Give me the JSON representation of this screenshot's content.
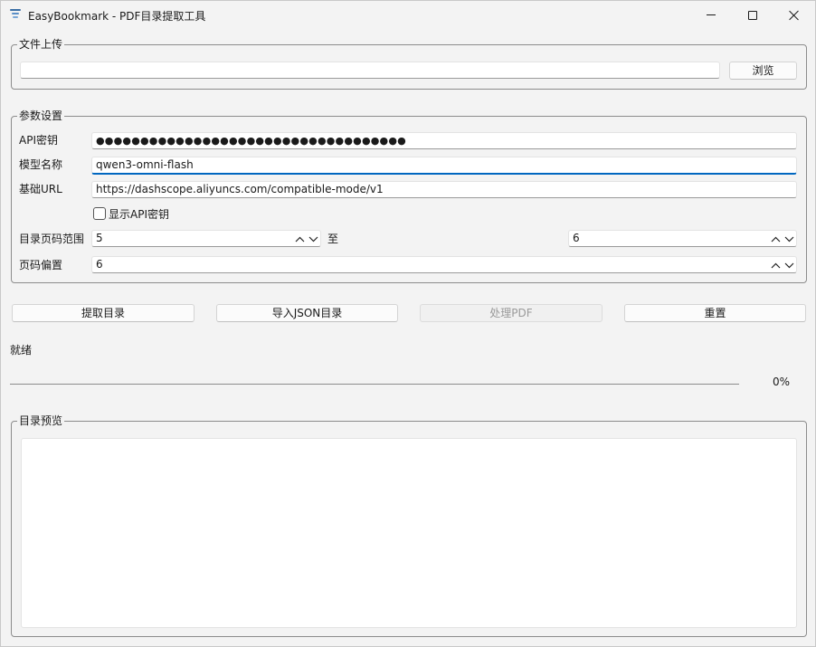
{
  "window": {
    "title": "EasyBookmark - PDF目录提取工具",
    "icon": "app-list-icon"
  },
  "upload": {
    "group_title": "文件上传",
    "file_path": "",
    "browse_label": "浏览"
  },
  "params": {
    "group_title": "参数设置",
    "api_key_label": "API密钥",
    "api_key_masked": "●●●●●●●●●●●●●●●●●●●●●●●●●●●●●●●●●●●",
    "model_label": "模型名称",
    "model_value": "qwen3-omni-flash",
    "base_url_label": "基础URL",
    "base_url_value": "https://dashscope.aliyuncs.com/compatible-mode/v1",
    "show_key_label": "显示API密钥",
    "show_key_checked": false,
    "range_label": "目录页码范围",
    "range_start": "5",
    "range_to": "至",
    "range_end": "6",
    "offset_label": "页码偏置",
    "offset_value": "6"
  },
  "actions": {
    "extract": "提取目录",
    "import_json": "导入JSON目录",
    "process_pdf": "处理PDF",
    "reset": "重置"
  },
  "status": {
    "text": "就绪",
    "progress_percent": 0,
    "progress_label": "0%"
  },
  "preview": {
    "group_title": "目录预览",
    "content": ""
  },
  "colors": {
    "accent": "#0067c0",
    "background": "#f3f3f3"
  }
}
